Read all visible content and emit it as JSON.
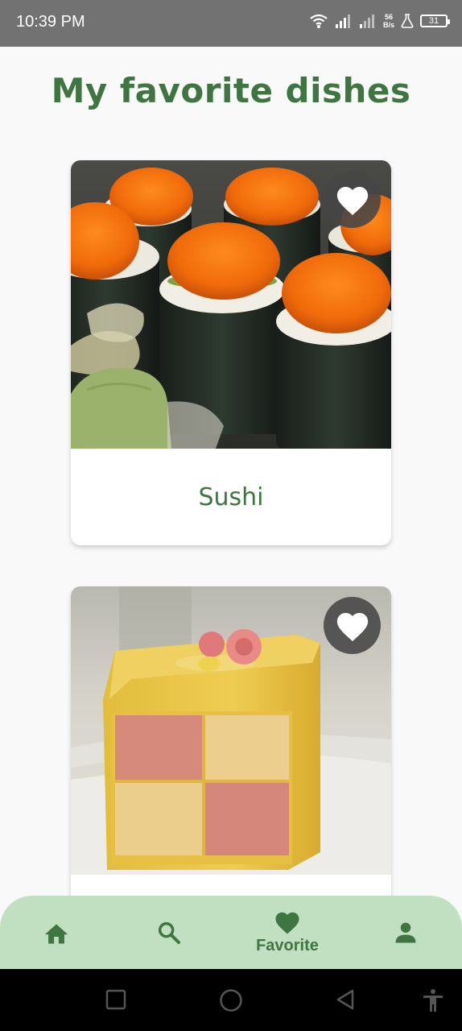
{
  "status_bar": {
    "time": "10:39 PM",
    "net_speed_value": "56",
    "net_speed_unit": "B/s",
    "battery": "31",
    "icons": [
      "wifi-icon",
      "signal-icon",
      "signal-icon",
      "flask-icon",
      "battery-icon"
    ]
  },
  "header": {
    "title": "My favorite dishes"
  },
  "cards": [
    {
      "label": "Sushi",
      "image": "sushi-photo",
      "favorite": true
    },
    {
      "label": "",
      "image": "battenberg-cake-photo",
      "favorite": true
    }
  ],
  "bottom_nav": {
    "items": [
      {
        "icon": "home-icon",
        "label": ""
      },
      {
        "icon": "search-icon",
        "label": ""
      },
      {
        "icon": "heart-icon",
        "label": "Favorite",
        "active": true
      },
      {
        "icon": "person-icon",
        "label": ""
      }
    ]
  },
  "system_nav": [
    "recents-button",
    "home-button",
    "back-button",
    "accessibility-button"
  ],
  "colors": {
    "accent_green": "#3f7541",
    "nav_background": "#c1e0c1",
    "status_bar": "#727272",
    "page_background": "#f9f9f9"
  }
}
